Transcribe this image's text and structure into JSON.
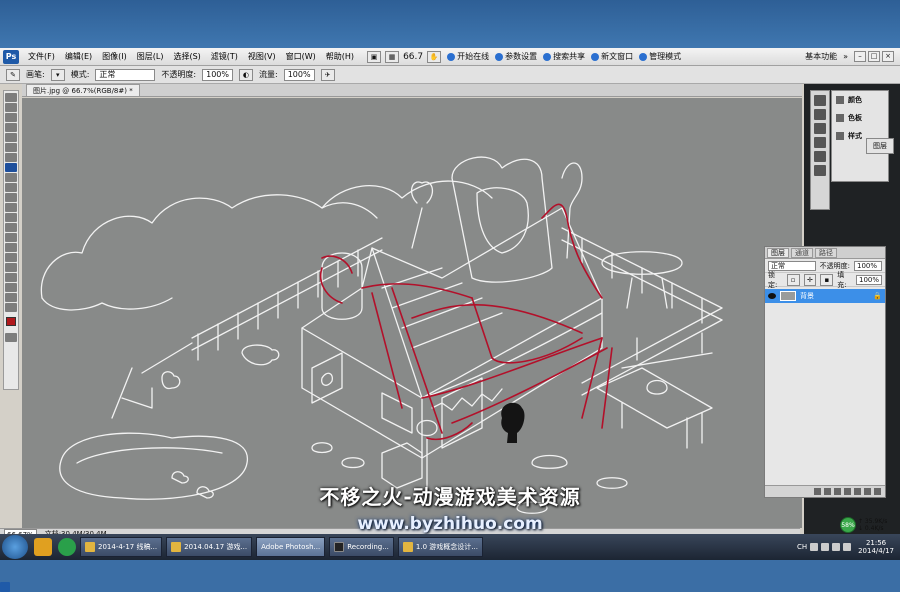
{
  "menubar": {
    "app_logo": "Ps",
    "items": [
      "文件(F)",
      "编辑(E)",
      "图像(I)",
      "图层(L)",
      "选择(S)",
      "滤镜(T)",
      "视图(V)",
      "窗口(W)",
      "帮助(H)"
    ],
    "zoom": "66.7",
    "bridge_items": [
      "开始在线",
      "参数设置",
      "搜索共享",
      "新文窗口",
      "管理模式"
    ],
    "workspace": "基本功能"
  },
  "options_bar": {
    "tool_label": "画笔:",
    "mode_label": "模式:",
    "mode_value": "正常",
    "opacity_label": "不透明度:",
    "opacity_value": "100%",
    "flow_label": "流量:",
    "flow_value": "100%"
  },
  "document": {
    "tab_title": "图片.jpg @ 66.7%(RGB/8#) *"
  },
  "status_bar": {
    "zoom": "66.67%",
    "doc_info": "文档:30.4M/30.4M"
  },
  "dock": {
    "labels": [
      "颜色",
      "色板",
      "样式"
    ],
    "nav_label": "图层"
  },
  "layers_panel": {
    "tabs": [
      "图层",
      "通道",
      "路径"
    ],
    "blend_mode": "正常",
    "opacity_label": "不透明度:",
    "opacity": "100%",
    "lock_label": "锁定:",
    "fill_label": "填充:",
    "fill": "100%",
    "layer_name": "背景"
  },
  "overlay": {
    "subtitle": "不移之火-动漫游戏美术资源",
    "watermark": "www.byzhihuo.com"
  },
  "taskbar": {
    "tasks": [
      {
        "label": "2014-4-17  线稿...",
        "icon": "folder"
      },
      {
        "label": "2014.04.17 游戏...",
        "icon": "folder"
      },
      {
        "label": "Adobe Photosh...",
        "icon": "ps"
      },
      {
        "label": "Recording...",
        "icon": "dark"
      },
      {
        "label": "1.0 游戏概念设计...",
        "icon": "folder"
      }
    ],
    "time": "21:56",
    "date": "2014/4/17",
    "lang": "CH",
    "net_badge": "58%",
    "net_up": "↑ 35.9K/s",
    "net_down": "↓ 0.4K/s"
  },
  "colors": {
    "desktop": "#3b6ea5",
    "canvas": "#888a89",
    "red_lines": "#b3102a",
    "foreground_swatch": "#b0191d",
    "selected_layer": "#3c8fe8"
  }
}
